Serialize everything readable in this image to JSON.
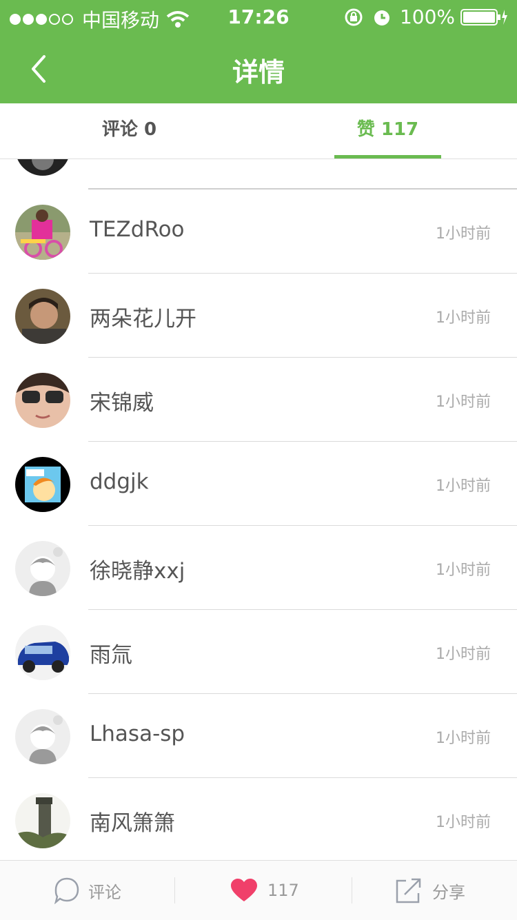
{
  "status_bar": {
    "carrier": "中国移动",
    "time": "17:26",
    "battery": "100%"
  },
  "nav": {
    "title": "详情"
  },
  "tabs": [
    {
      "label": "评论 0",
      "active": false
    },
    {
      "label": "赞 117",
      "active": true
    }
  ],
  "likes": [
    {
      "name": "TEZdRoo",
      "time": "1小时前",
      "avatar": "photo-girl-bike"
    },
    {
      "name": "两朵花儿开",
      "time": "1小时前",
      "avatar": "photo-portrait"
    },
    {
      "name": "宋锦威",
      "time": "1小时前",
      "avatar": "photo-sunglasses"
    },
    {
      "name": "ddgjk",
      "time": "1小时前",
      "avatar": "cartoon"
    },
    {
      "name": "徐晓静xxj",
      "time": "1小时前",
      "avatar": "default"
    },
    {
      "name": "雨氚",
      "time": "1小时前",
      "avatar": "photo-car"
    },
    {
      "name": "Lhasa-sp",
      "time": "1小时前",
      "avatar": "default"
    },
    {
      "name": "南风箫箫",
      "time": "1小时前",
      "avatar": "photo-statue"
    }
  ],
  "bottom_bar": {
    "comment_label": "评论",
    "like_count": "117",
    "share_label": "分享"
  },
  "colors": {
    "accent": "#6abb50",
    "heart": "#f0406a"
  }
}
